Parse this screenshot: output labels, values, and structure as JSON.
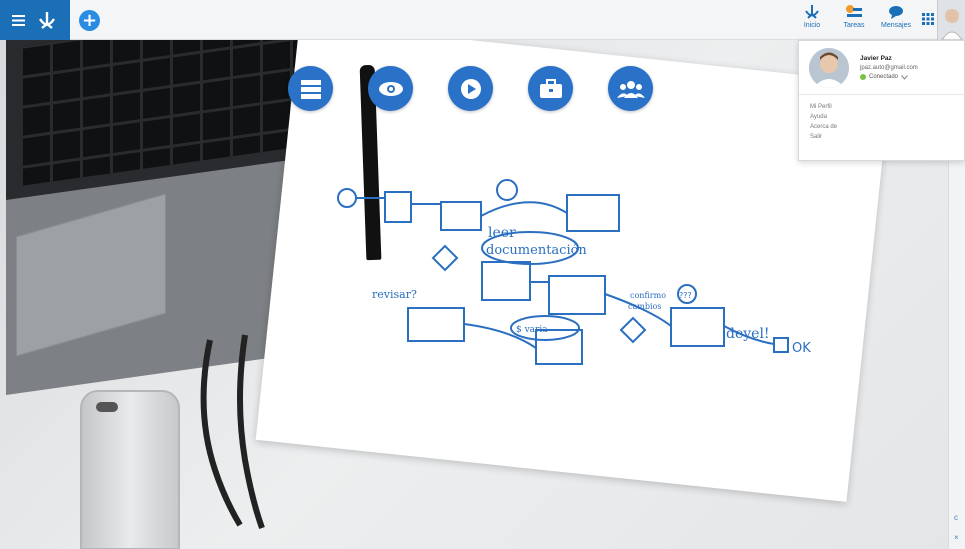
{
  "topbar": {
    "add_label": "+",
    "nav": [
      {
        "label": "Inicio",
        "icon": "home-icon"
      },
      {
        "label": "Tareas",
        "icon": "tasks-icon"
      },
      {
        "label": "Mensajes",
        "icon": "messages-icon"
      }
    ]
  },
  "actions": [
    {
      "icon": "process-list-icon"
    },
    {
      "icon": "eye-icon"
    },
    {
      "icon": "play-icon"
    },
    {
      "icon": "briefcase-icon"
    },
    {
      "icon": "users-icon"
    }
  ],
  "user": {
    "name": "Javier Paz",
    "email": "jpaz.auto@gmail.com",
    "status": "Conectado",
    "menu": [
      "Mi Perfil",
      "Ayuda",
      "Acerca de",
      "Salir"
    ]
  },
  "sketch": {
    "texts": [
      "leer",
      "documentación",
      "revisar?",
      "confirmo",
      "cambios",
      "$ varia",
      "deyel!",
      "OK",
      "???"
    ]
  },
  "side_strip": {
    "top_glyph": "c",
    "bottom_glyph": "×"
  },
  "colors": {
    "brand": "#1b6fb7",
    "accent": "#2a72c8",
    "status_online": "#7ac142"
  }
}
